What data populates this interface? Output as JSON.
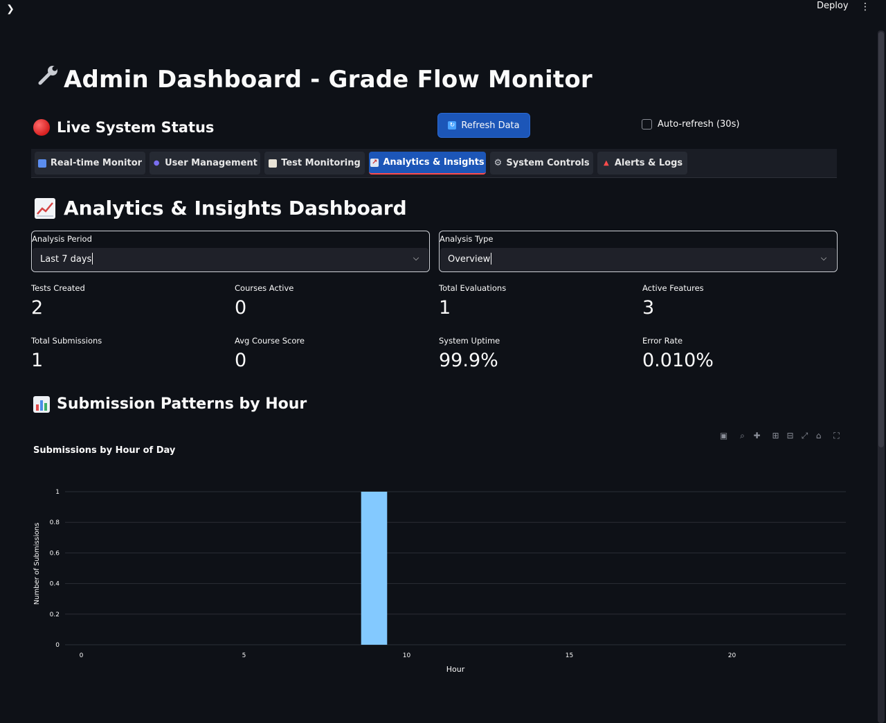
{
  "topbar": {
    "deploy_label": "Deploy",
    "menu_icon": "kebab-icon",
    "sidebar_icon": "chevron-right-icon"
  },
  "page": {
    "title": "Admin Dashboard - Grade Flow Monitor",
    "title_icon": "wrench-icon"
  },
  "status": {
    "heading": "Live System Status",
    "icon": "red-circle-icon"
  },
  "refresh": {
    "label": "Refresh Data",
    "icon": "refresh-icon"
  },
  "autorefresh": {
    "label": "Auto-refresh (30s)",
    "checked": false
  },
  "tabs": [
    {
      "label": "Real-time Monitor",
      "icon": "bar-chart-icon",
      "active": false
    },
    {
      "label": "User Management",
      "icon": "users-icon",
      "active": false
    },
    {
      "label": "Test Monitoring",
      "icon": "clipboard-icon",
      "active": false
    },
    {
      "label": "Analytics & Insights",
      "icon": "chart-up-icon",
      "active": true
    },
    {
      "label": "System Controls",
      "icon": "gear-icon",
      "active": false
    },
    {
      "label": "Alerts & Logs",
      "icon": "siren-icon",
      "active": false
    }
  ],
  "analytics": {
    "heading": "Analytics & Insights Dashboard",
    "icon": "chart-up-icon"
  },
  "filters": {
    "period": {
      "label": "Analysis Period",
      "value": "Last 7 days"
    },
    "type": {
      "label": "Analysis Type",
      "value": "Overview"
    }
  },
  "metrics": [
    {
      "label": "Tests Created",
      "value": "2"
    },
    {
      "label": "Courses Active",
      "value": "0"
    },
    {
      "label": "Total Evaluations",
      "value": "1"
    },
    {
      "label": "Active Features",
      "value": "3"
    },
    {
      "label": "Total Submissions",
      "value": "1"
    },
    {
      "label": "Avg Course Score",
      "value": "0"
    },
    {
      "label": "System Uptime",
      "value": "99.9%"
    },
    {
      "label": "Error Rate",
      "value": "0.010%"
    }
  ],
  "patterns": {
    "heading": "Submission Patterns by Hour",
    "icon": "bar-chart-icon"
  },
  "modebar": [
    "camera-icon",
    "zoom-icon",
    "pan-icon",
    "zoom-in-icon",
    "zoom-out-icon",
    "autoscale-icon",
    "home-icon",
    "fullscreen-icon"
  ],
  "colors": {
    "bar": "#83c9ff",
    "accent": "#1c56b8",
    "tab_underline": "#ff4b4b",
    "background": "#0e1117"
  },
  "chart_data": {
    "type": "bar",
    "title": "Submissions by Hour of Day",
    "xlabel": "Hour",
    "ylabel": "Number of Submissions",
    "x": [
      9
    ],
    "values": [
      1
    ],
    "xlim": [
      -0.5,
      23.5
    ],
    "ylim": [
      0,
      1
    ],
    "xticks": [
      0,
      5,
      10,
      15,
      20
    ],
    "yticks": [
      0,
      0.2,
      0.4,
      0.6,
      0.8,
      1
    ],
    "ytick_labels": [
      "0",
      "0.2",
      "0.4",
      "0.6",
      "0.8",
      "1"
    ],
    "grid": true
  }
}
